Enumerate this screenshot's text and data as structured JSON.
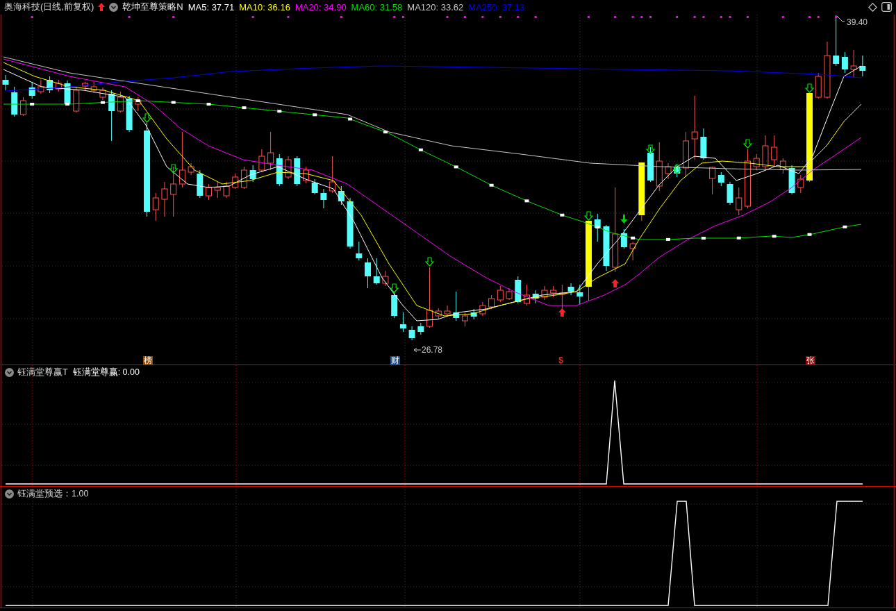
{
  "header": {
    "title": "奥海科技(日线,前复权)",
    "strategy": "乾坤至尊策略N",
    "indicators": [
      {
        "label": "MA5: 37.71",
        "color": "#ffffff"
      },
      {
        "label": "MA10: 36.16",
        "color": "#ffff00"
      },
      {
        "label": "MA20: 34.90",
        "color": "#ff00ff"
      },
      {
        "label": "MA60: 31.58",
        "color": "#00e000"
      },
      {
        "label": "MA120: 33.62",
        "color": "#c8c8c8"
      },
      {
        "label": "MA250: 37.13",
        "color": "#0000ff"
      }
    ]
  },
  "price_chart": {
    "high_label": "39.40",
    "low_label": "26.78",
    "markers": [
      {
        "text": "榜",
        "kind": "tag",
        "color": "#8b4a0c"
      },
      {
        "text": "财",
        "kind": "tag",
        "color": "#1c4c8c"
      },
      {
        "text": "$",
        "kind": "glyph",
        "color": "#ff2020"
      },
      {
        "text": "张",
        "kind": "tag",
        "color": "#8b0a0a"
      }
    ]
  },
  "panels": [
    {
      "title": "钰满堂尊赢T",
      "reading": "钰满堂尊赢: 0.00"
    },
    {
      "title": "钰满堂预选：1.00"
    }
  ]
}
